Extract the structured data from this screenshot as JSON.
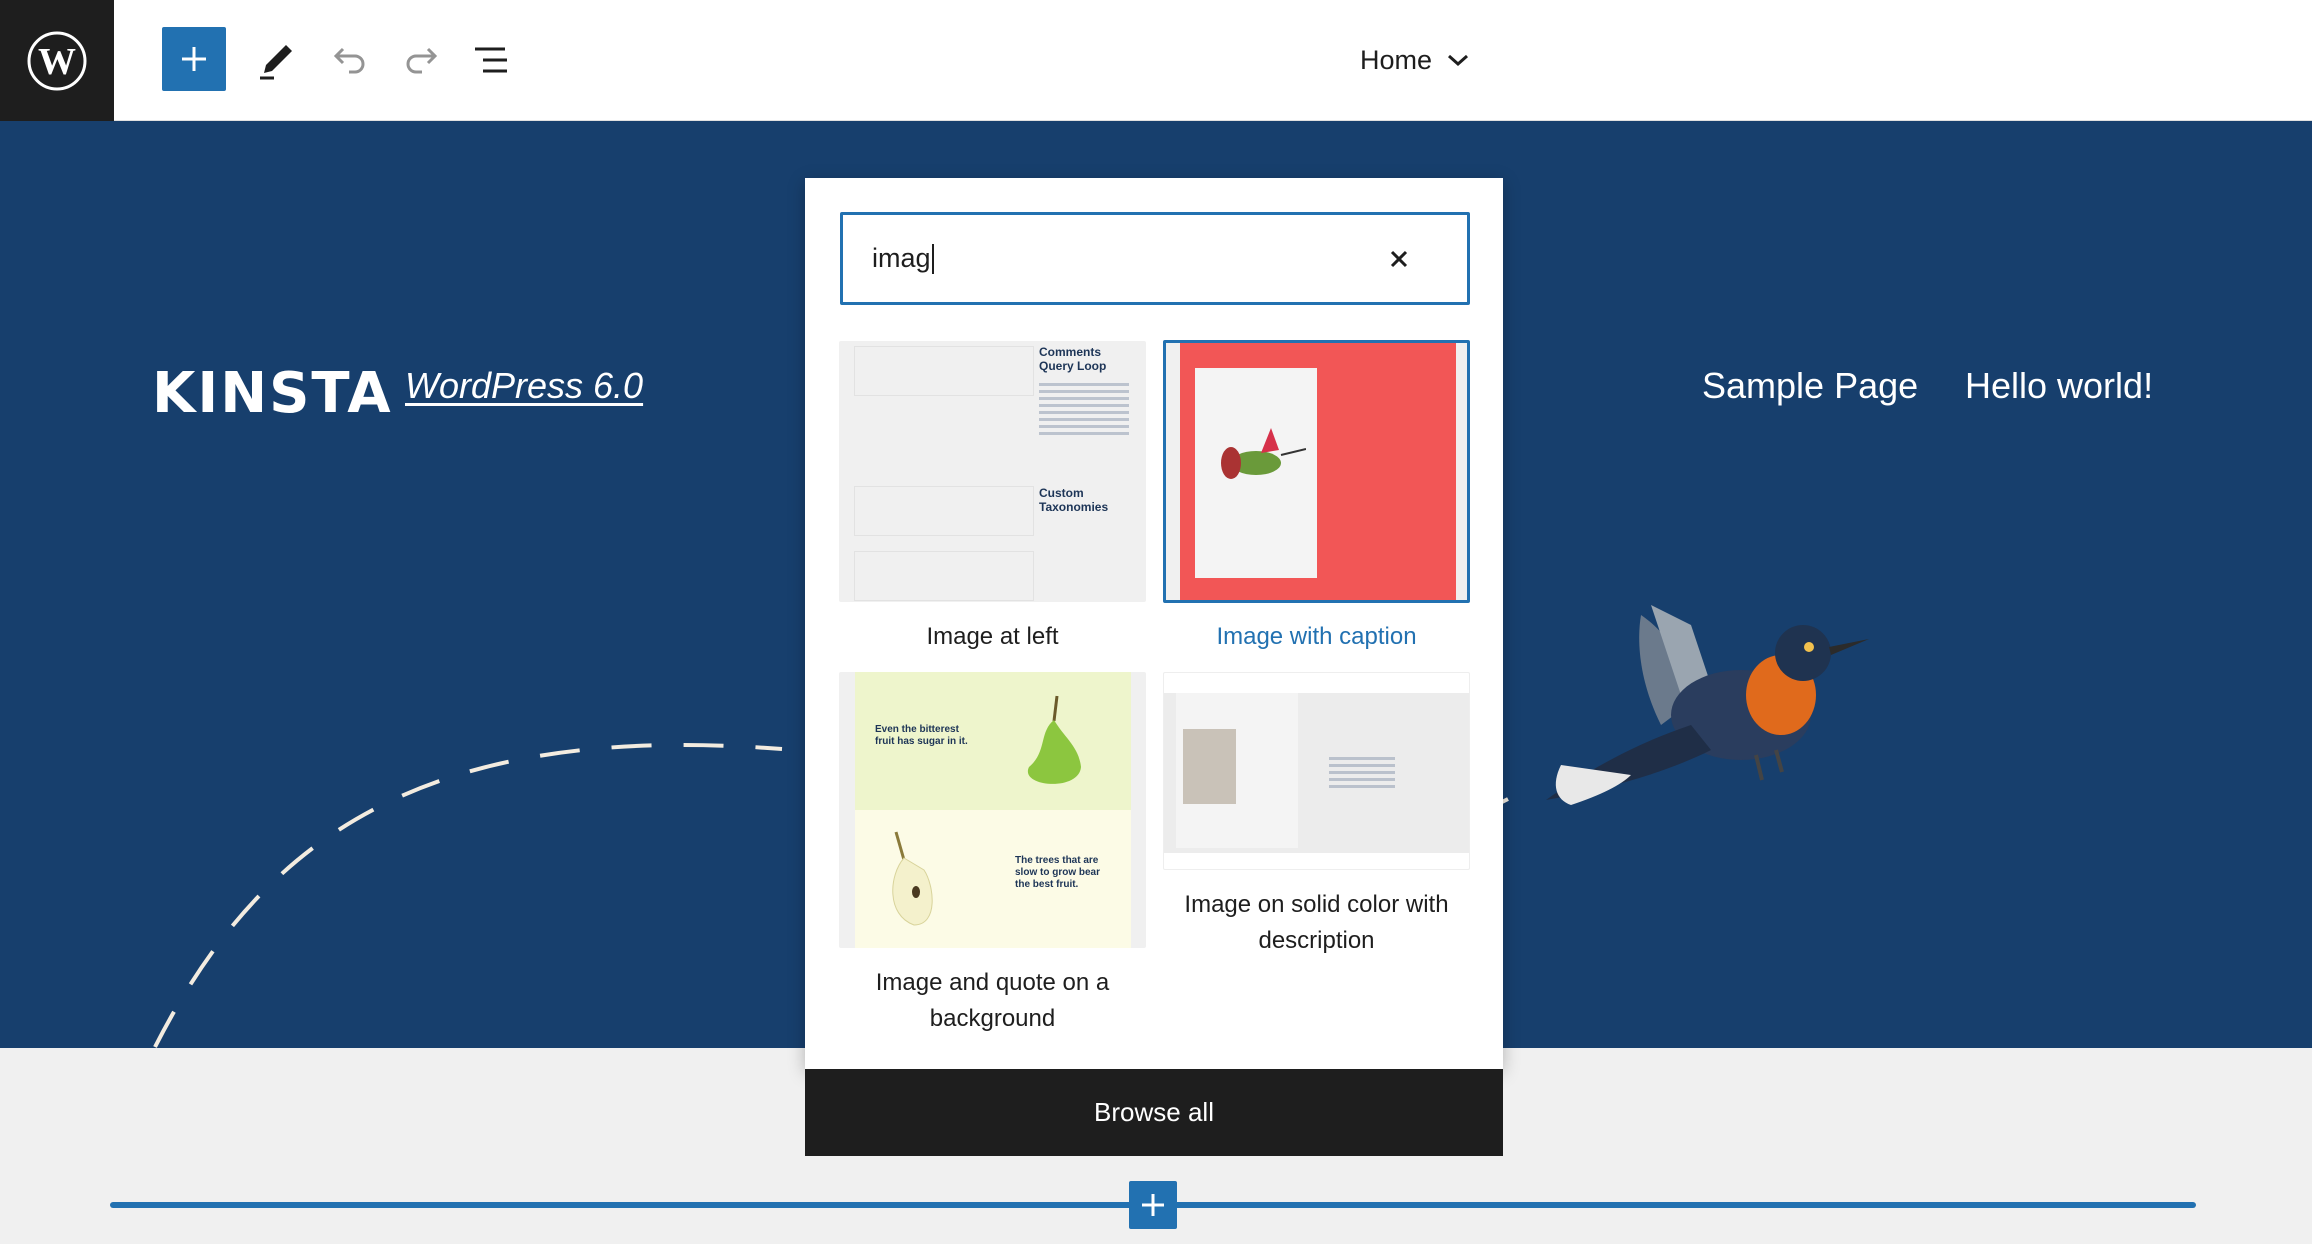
{
  "toolbar": {
    "logo": "wordpress-logo",
    "add_block": "plus-icon",
    "tools": [
      "pencil-icon",
      "undo-icon",
      "redo-icon",
      "list-view-icon"
    ],
    "template": "Home"
  },
  "site": {
    "logo_text": "KINSTA",
    "tagline": "WordPress 6.0",
    "nav": [
      "Sample Page",
      "Hello world!"
    ]
  },
  "inserter": {
    "search_value": "imag",
    "patterns": [
      {
        "label": "Image at left",
        "thumb_texts": [
          "Comments Query Loop",
          "Custom Taxonomies"
        ],
        "selected": false
      },
      {
        "label": "Image with caption",
        "selected": true
      },
      {
        "label": "Image and quote on a background",
        "thumb_texts": [
          "Even the bitterest fruit has sugar in it.",
          "The trees that are slow to grow bear the best fruit."
        ],
        "selected": false
      },
      {
        "label": "Image on solid color with description",
        "selected": false
      }
    ],
    "browse_all": "Browse all"
  },
  "colors": {
    "accent": "#2271b1",
    "hero": "#173f6d",
    "dark": "#1e1e1e",
    "caption_bg": "#f25656"
  }
}
